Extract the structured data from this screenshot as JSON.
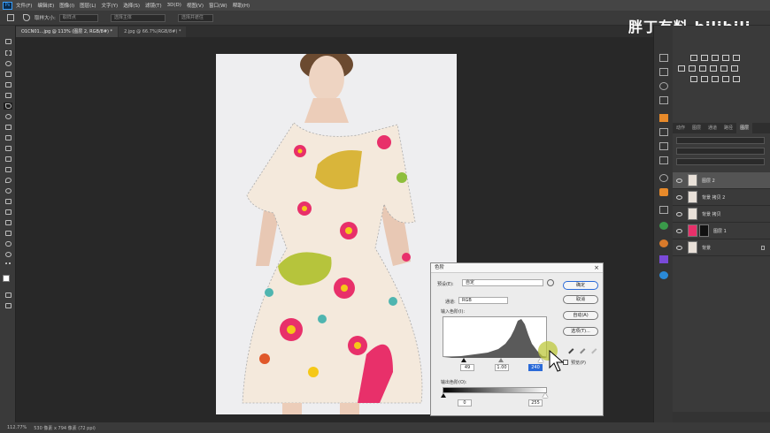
{
  "menubar": {
    "items": [
      "文件(F)",
      "编辑(E)",
      "图像(I)",
      "图层(L)",
      "文字(Y)",
      "选择(S)",
      "滤镜(T)",
      "3D(D)",
      "视图(V)",
      "窗口(W)",
      "帮助(H)"
    ]
  },
  "options": {
    "label": "取样大小:",
    "sample_value": "取样点",
    "field2": "选择主体",
    "field3": "选择并遮住"
  },
  "tabs": [
    {
      "label": "O1CN01...jpg @ 113% (图层 2, RGB/8#) *",
      "active": true
    },
    {
      "label": "2.jpg @ 66.7%(RGB/8#) *",
      "active": false
    }
  ],
  "watermark": "胖丁有料 bilibili",
  "layers_panel": {
    "tabs": [
      "动作",
      "图层",
      "通道",
      "路径",
      "图层"
    ],
    "layers": [
      {
        "name": "图层 2",
        "active": true
      },
      {
        "name": "背景 拷贝 2",
        "active": false
      },
      {
        "name": "背景 拷贝",
        "active": false
      },
      {
        "name": "图层 1",
        "active": false
      },
      {
        "name": "背景",
        "active": false
      }
    ]
  },
  "dialog": {
    "title": "色阶",
    "close": "×",
    "preset_label": "预设(E):",
    "preset_value": "自定",
    "channel_label": "通道:",
    "channel_value": "RGB",
    "input_label": "输入色阶(I):",
    "output_label": "输出色阶(O):",
    "input_black": "49",
    "input_gamma": "1.00",
    "input_white": "240",
    "output_black": "0",
    "output_white": "255",
    "ok": "确定",
    "cancel": "取消",
    "auto": "自动(A)",
    "options": "选项(T)...",
    "preview_label": "预览(P)",
    "preview_checked": true
  },
  "status": {
    "zoom": "112.77%",
    "doc": "530 像素 x 794 像素 (72 ppi)"
  },
  "colors": {
    "accent": "#2a6ad8",
    "cursor_halo": "#bec83c"
  }
}
